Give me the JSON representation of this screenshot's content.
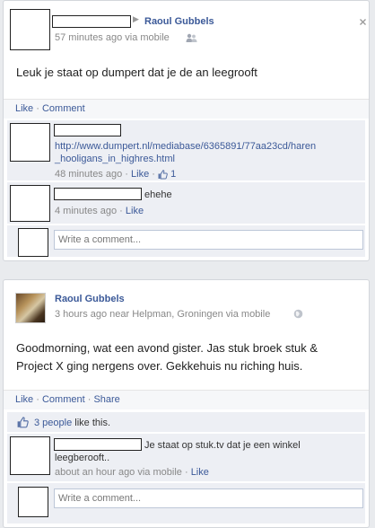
{
  "post1": {
    "author": "Raoul Gubbels",
    "time": "57 minutes ago via mobile",
    "text": "Leuk je staat op dumpert dat je de an leegrooft",
    "actions": {
      "like": "Like",
      "sep": " · ",
      "comment": "Comment"
    },
    "comments": [
      {
        "link_line1": "http://www.dumpert.nl/mediabase/6365891/77aa23cd/haren",
        "link_line2": "_hooligans_in_highres.html",
        "time": "48 minutes ago",
        "like": "Like",
        "like_count": "1"
      },
      {
        "text": "ehehe",
        "time": "4 minutes ago",
        "like": "Like"
      }
    ],
    "write_placeholder": "Write a comment..."
  },
  "post2": {
    "author": "Raoul Gubbels",
    "time": "3 hours ago near Helpman, Groningen via mobile",
    "text_line1": "Goodmorning, wat een avond gister. Jas stuk broek stuk &",
    "text_line2": "Project X ging nergens over. Gekkehuis nu riching huis.",
    "actions": {
      "like": "Like",
      "comment": "Comment",
      "share": "Share"
    },
    "likes": {
      "count_link": "3 people",
      "suffix": " like this."
    },
    "comment": {
      "text_line1": "Je staat op stuk.tv dat je een winkel",
      "text_line2": "leegberooft..",
      "time": "about an hour ago via mobile",
      "like": "Like"
    },
    "write_placeholder": "Write a comment..."
  }
}
